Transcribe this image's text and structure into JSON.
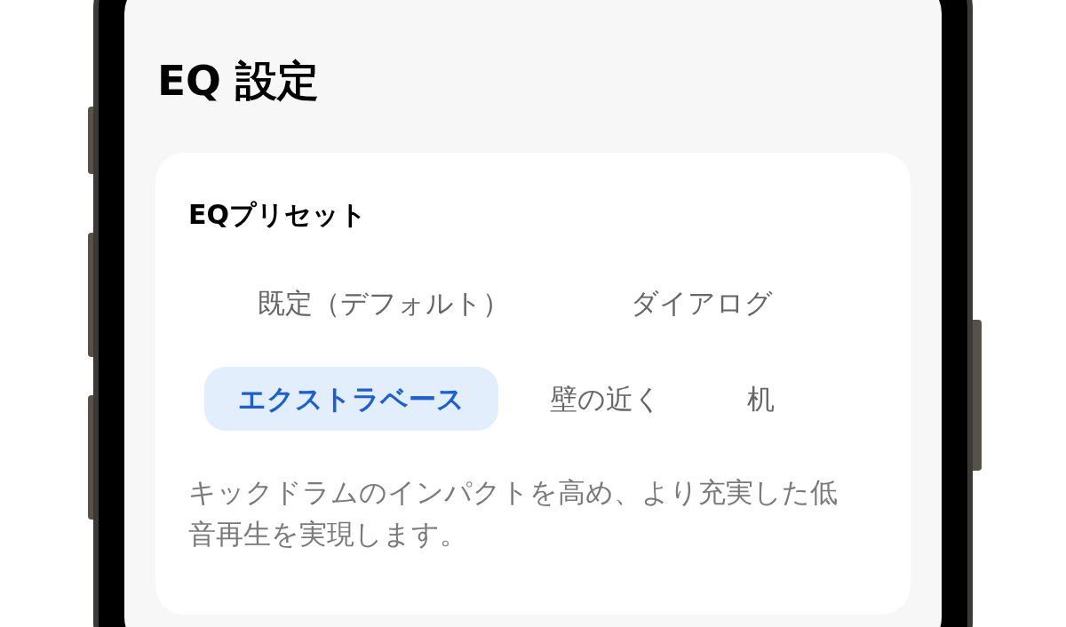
{
  "title": "EQ 設定",
  "card": {
    "heading": "EQプリセット",
    "preset_rows": [
      [
        {
          "label": "既定（デフォルト）",
          "selected": false
        },
        {
          "label": "ダイアログ",
          "selected": false
        }
      ],
      [
        {
          "label": "エクストラベース",
          "selected": true
        },
        {
          "label": "壁の近く",
          "selected": false
        },
        {
          "label": "机",
          "selected": false
        }
      ]
    ],
    "description": "キックドラムのインパクトを高め、より充実した低音再生を実現します。"
  }
}
